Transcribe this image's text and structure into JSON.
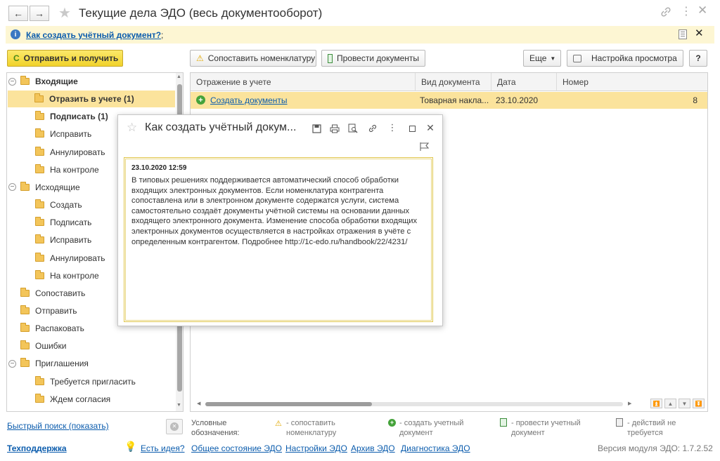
{
  "window": {
    "title": "Текущие дела ЭДО (весь документооборот)"
  },
  "help_bar": {
    "link": "Как создать учётный документ?",
    "suffix": ";"
  },
  "toolbar": {
    "send_receive": "Отправить и получить",
    "match_nomenclature": "Сопоставить номенклатуру",
    "post_documents": "Провести документы",
    "more": "Еще",
    "view_settings": "Настройка просмотра",
    "help": "?"
  },
  "tree": [
    {
      "label": "Входящие",
      "level": 0,
      "bold": true,
      "toggle": "−"
    },
    {
      "label": "Отразить в учете (1)",
      "level": 1,
      "bold": true,
      "selected": true
    },
    {
      "label": "Подписать (1)",
      "level": 1,
      "bold": true
    },
    {
      "label": "Исправить",
      "level": 1
    },
    {
      "label": "Аннулировать",
      "level": 1
    },
    {
      "label": "На контроле",
      "level": 1
    },
    {
      "label": "Исходящие",
      "level": 0,
      "toggle": "−"
    },
    {
      "label": "Создать",
      "level": 1
    },
    {
      "label": "Подписать",
      "level": 1
    },
    {
      "label": "Исправить",
      "level": 1
    },
    {
      "label": "Аннулировать",
      "level": 1
    },
    {
      "label": "На контроле",
      "level": 1
    },
    {
      "label": "Сопоставить",
      "level": 0
    },
    {
      "label": "Отправить",
      "level": 0
    },
    {
      "label": "Распаковать",
      "level": 0
    },
    {
      "label": "Ошибки",
      "level": 0
    },
    {
      "label": "Приглашения",
      "level": 0,
      "toggle": "−"
    },
    {
      "label": "Требуется пригласить",
      "level": 1
    },
    {
      "label": "Ждем согласия",
      "level": 1
    }
  ],
  "table": {
    "columns": [
      "Отражение в учете",
      "Вид документа",
      "Дата",
      "Номер"
    ],
    "rows": [
      {
        "reflection": "Создать документы",
        "doc_type": "Товарная накла...",
        "date": "23.10.2020",
        "number": "8"
      }
    ]
  },
  "popup": {
    "title": "Как создать учётный докум...",
    "timestamp": "23.10.2020 12:59",
    "body": "В типовых решениях поддерживается автоматический способ обработки входящих электронных документов. Если номенклатура контрагента сопоставлена или в электронном документе содержатся услуги, система самостоятельно создаёт документы учётной системы на основании данных входящего электронного документа. Изменение способа обработки входящих электронных документов осуществляется в настройках отражения в учёте с определенным контрагентом. Подробнее http://1c-edo.ru/handbook/22/4231/"
  },
  "footer": {
    "quick_search": "Быстрый поиск (показать)",
    "legend_title": "Условные обозначения:",
    "legend": [
      "- сопоставить номенклатуру",
      "- создать учетный документ",
      "- провести учетный документ",
      "- действий не требуется"
    ],
    "support": "Техподдержка",
    "idea": "Есть идея?",
    "links": [
      "Общее состояние ЭДО",
      "Настройки ЭДО",
      "Архив ЭДО",
      "Диагностика ЭДО"
    ],
    "version": "Версия модуля ЭДО: 1.7.2.52"
  },
  "colors": {
    "selected_row": "#fbe39c",
    "send_button": "#f6de3c",
    "help_bar": "#fdf6d3",
    "link": "#0b5cad"
  }
}
